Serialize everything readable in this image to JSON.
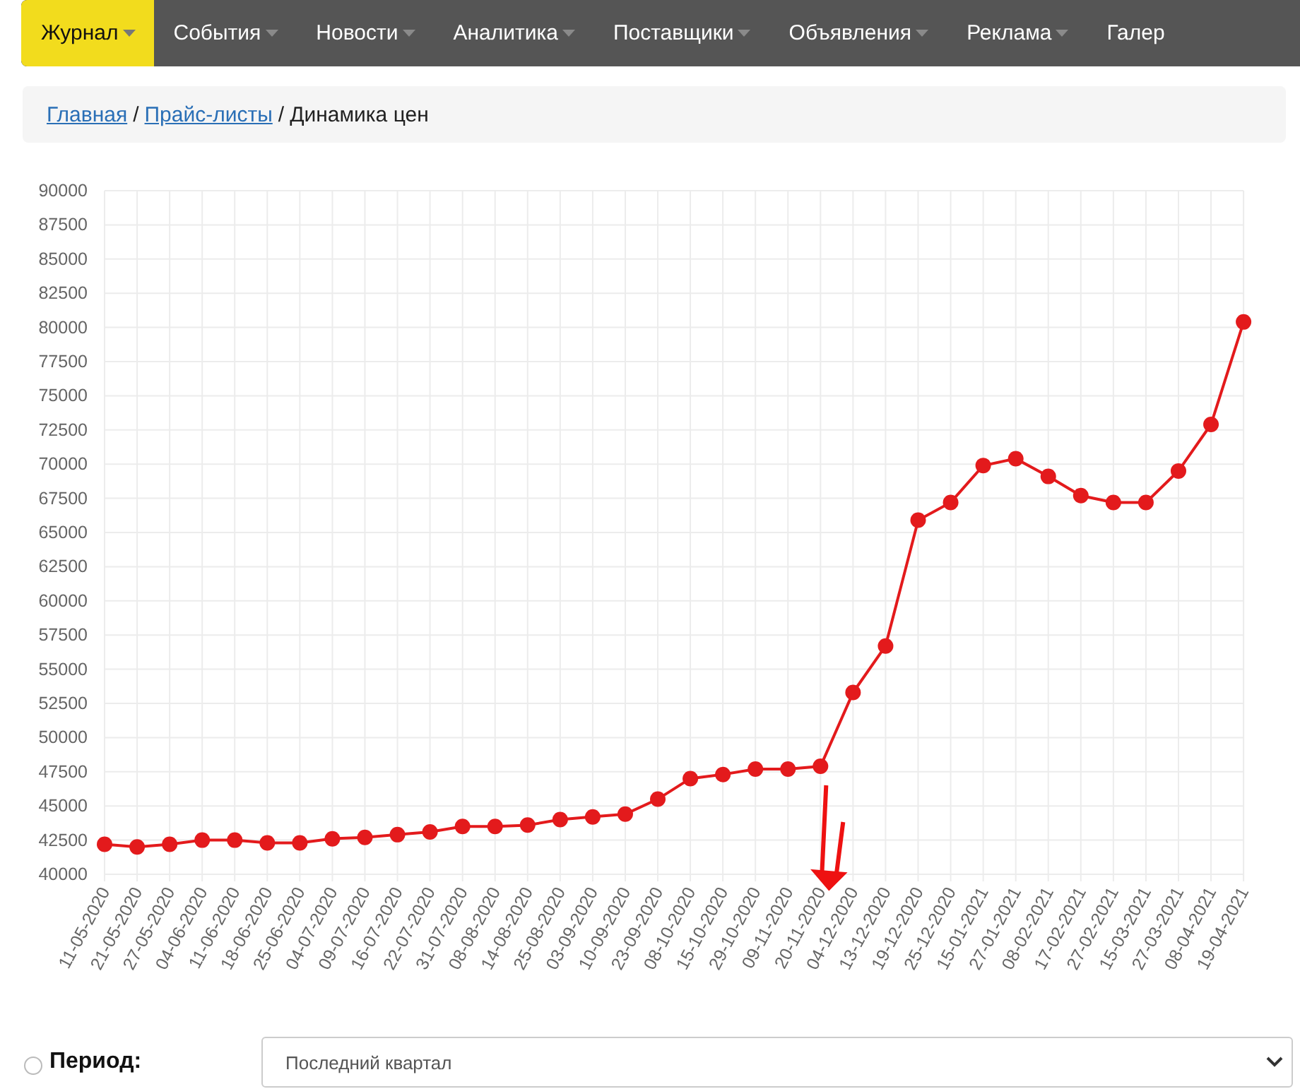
{
  "nav": [
    {
      "label": "Журнал",
      "selected": true
    },
    {
      "label": "События",
      "selected": false
    },
    {
      "label": "Новости",
      "selected": false
    },
    {
      "label": "Аналитика",
      "selected": false
    },
    {
      "label": "Поставщики",
      "selected": false
    },
    {
      "label": "Объявления",
      "selected": false
    },
    {
      "label": "Реклама",
      "selected": false
    },
    {
      "label": "Галер",
      "selected": false
    }
  ],
  "breadcrumb_separator": "/",
  "breadcrumb": [
    {
      "label": "Главная",
      "kind": "link"
    },
    {
      "label": "Прайс-листы",
      "kind": "link"
    },
    {
      "label": "Динамика цен",
      "kind": "current"
    }
  ],
  "chart_data": {
    "type": "line",
    "categories": [
      "11-05-2020",
      "21-05-2020",
      "27-05-2020",
      "04-06-2020",
      "11-06-2020",
      "18-06-2020",
      "25-06-2020",
      "04-07-2020",
      "09-07-2020",
      "16-07-2020",
      "22-07-2020",
      "31-07-2020",
      "08-08-2020",
      "14-08-2020",
      "25-08-2020",
      "03-09-2020",
      "10-09-2020",
      "23-09-2020",
      "08-10-2020",
      "15-10-2020",
      "29-10-2020",
      "09-11-2020",
      "20-11-2020",
      "04-12-2020",
      "13-12-2020",
      "19-12-2020",
      "25-12-2020",
      "15-01-2021",
      "27-01-2021",
      "08-02-2021",
      "17-02-2021",
      "27-02-2021",
      "15-03-2021",
      "27-03-2021",
      "08-04-2021",
      "19-04-2021"
    ],
    "grid": true,
    "series": [
      {
        "color": "#e31a1c",
        "marker": "circle",
        "values": [
          42200,
          42000,
          42200,
          42500,
          42500,
          42300,
          42300,
          42600,
          42700,
          42900,
          43100,
          43500,
          43500,
          43600,
          44000,
          44200,
          44400,
          45500,
          47000,
          47300,
          47700,
          47700,
          47900,
          53300,
          56700,
          65900,
          67200,
          69900,
          70400,
          69100,
          67700,
          67200,
          67200,
          69500,
          72900,
          80400
        ]
      }
    ],
    "ylim": [
      40000,
      90000
    ],
    "yticks": [
      40000,
      42500,
      45000,
      47500,
      50000,
      52500,
      55000,
      57500,
      60000,
      62500,
      65000,
      67500,
      70000,
      72500,
      75000,
      77500,
      80000,
      82500,
      85000,
      87500,
      90000
    ],
    "annotations": [
      {
        "x": "20-11-2020"
      }
    ]
  },
  "period": {
    "label": "Период:",
    "selected": false,
    "value": "Последний квартал"
  }
}
